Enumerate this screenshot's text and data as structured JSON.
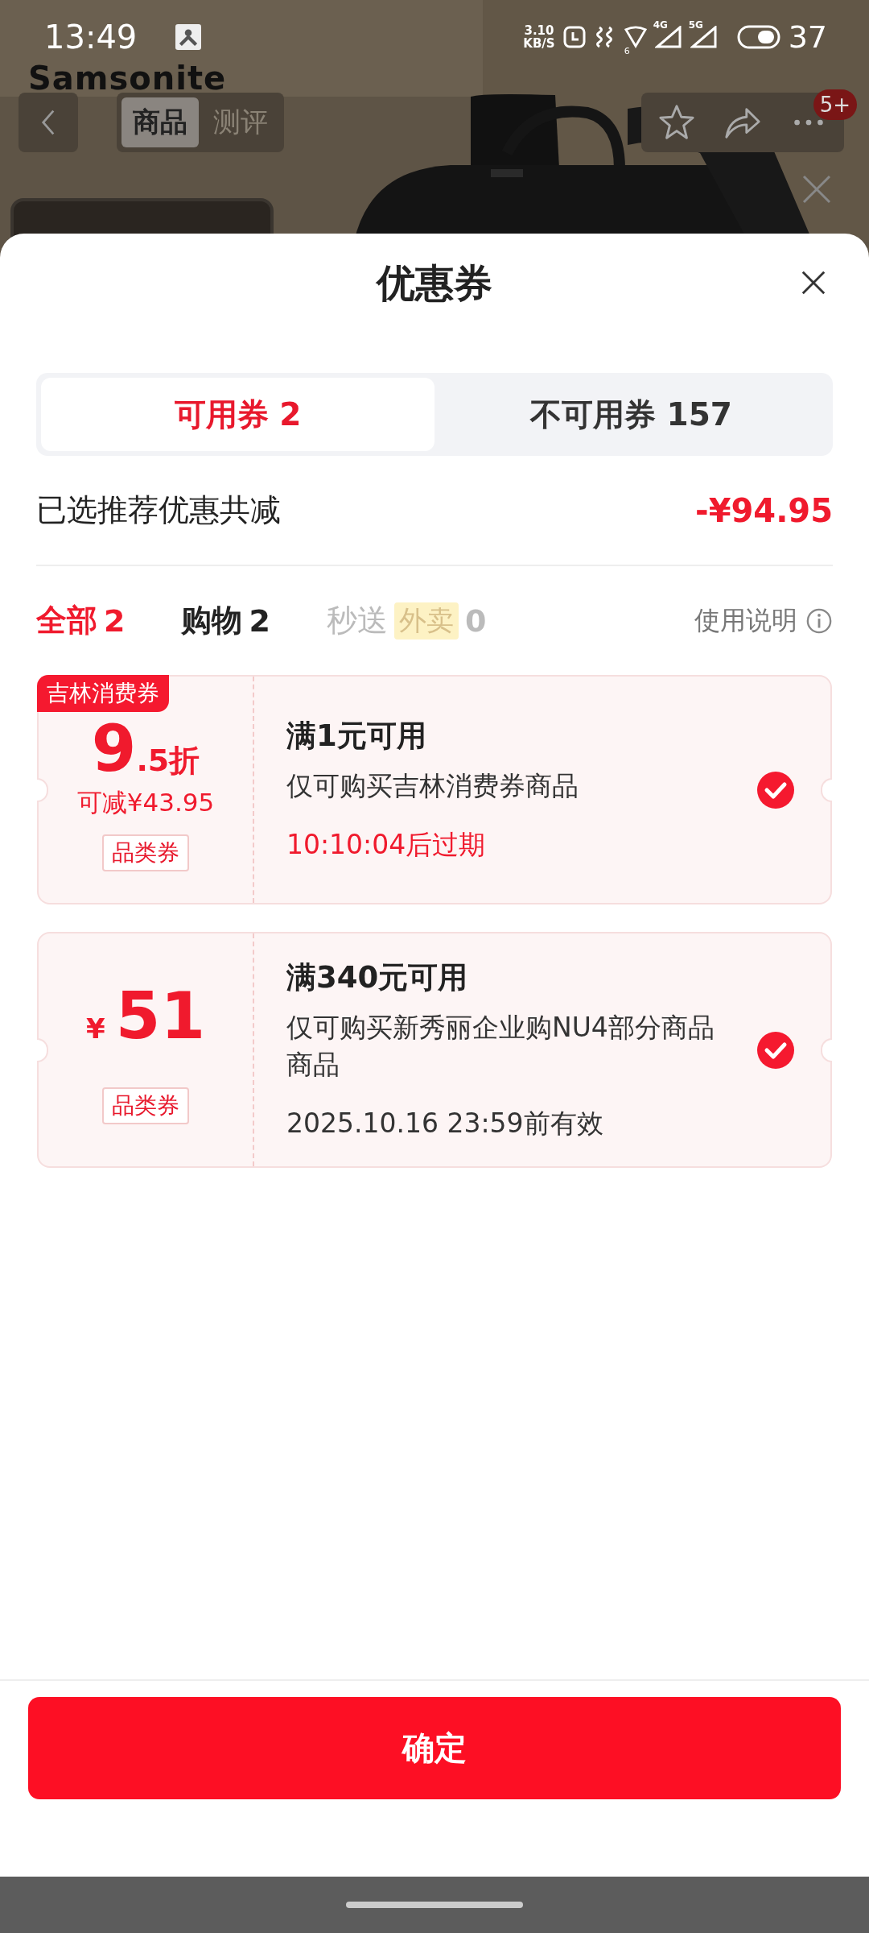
{
  "status_bar": {
    "time": "13:49",
    "speed_value": "3.10",
    "speed_unit": "KB/S",
    "wifi_badge": "6",
    "signal_1": "4G",
    "signal_2": "5G",
    "battery": "37"
  },
  "product_page": {
    "logo": "Samsonite",
    "tabs": [
      {
        "label": "商品",
        "selected": true
      },
      {
        "label": "测评",
        "selected": false
      }
    ],
    "cart_badge": "5+"
  },
  "sheet": {
    "title": "优惠券",
    "tabs": [
      {
        "label": "可用券 2",
        "selected": true
      },
      {
        "label": "不可用券 157",
        "selected": false
      }
    ],
    "summary": {
      "label": "已选推荐优惠共减",
      "amount": "-¥94.95"
    },
    "filters": [
      {
        "label": "全部",
        "count": "2",
        "selected": true,
        "disabled": false
      },
      {
        "label": "购物",
        "count": "2",
        "selected": false,
        "disabled": false
      },
      {
        "label": "秒送",
        "tag": "外卖",
        "count": "0",
        "selected": false,
        "disabled": true
      }
    ],
    "help": "使用说明",
    "coupons": [
      {
        "kind": "discount",
        "corner_tag": "吉林消费券",
        "value_main": "9",
        "value_suffix": ".5折",
        "saving": "可减¥43.95",
        "type_tag": "品类券",
        "title": "满1元可用",
        "description": "仅可购买吉林消费券商品",
        "expiry": "10:10:04后过期",
        "expiry_urgent": true,
        "checked": true
      },
      {
        "kind": "amount",
        "currency": "¥",
        "value_main": "51",
        "type_tag": "品类券",
        "title": "满340元可用",
        "description": "仅可购买新秀丽企业购NU4部分商品商品",
        "expiry": "2025.10.16 23:59前有效",
        "expiry_urgent": false,
        "checked": true
      }
    ],
    "confirm": "确定"
  }
}
